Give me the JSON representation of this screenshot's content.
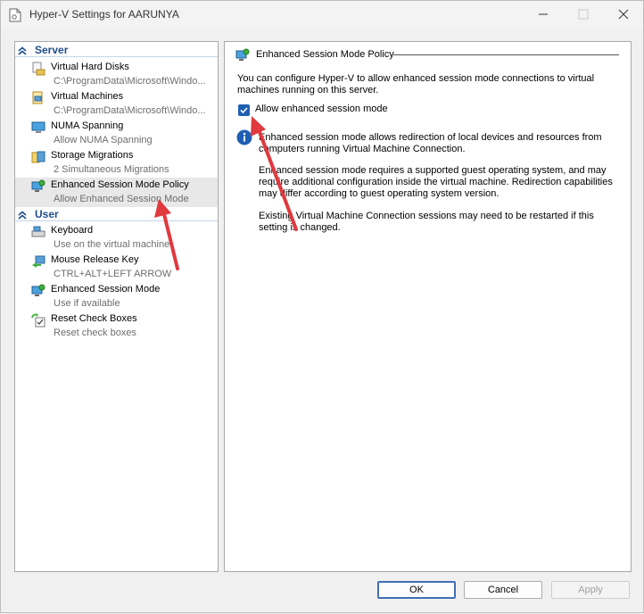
{
  "window": {
    "title": "Hyper-V Settings for AARUNYA"
  },
  "sidebar": {
    "categories": [
      {
        "label": "Server",
        "items": [
          {
            "title": "Virtual Hard Disks",
            "subtitle": "C:\\ProgramData\\Microsoft\\Windo...",
            "icon": "hard-disk-folder-icon"
          },
          {
            "title": "Virtual Machines",
            "subtitle": "C:\\ProgramData\\Microsoft\\Windo...",
            "icon": "virtual-machine-folder-icon"
          },
          {
            "title": "NUMA Spanning",
            "subtitle": "Allow NUMA Spanning",
            "icon": "numa-monitor-icon"
          },
          {
            "title": "Storage Migrations",
            "subtitle": "2 Simultaneous Migrations",
            "icon": "storage-migration-icon"
          },
          {
            "title": "Enhanced Session Mode Policy",
            "subtitle": "Allow Enhanced Session Mode",
            "icon": "enhanced-session-icon",
            "selected": true
          }
        ]
      },
      {
        "label": "User",
        "items": [
          {
            "title": "Keyboard",
            "subtitle": "Use on the virtual machine",
            "icon": "keyboard-icon"
          },
          {
            "title": "Mouse Release Key",
            "subtitle": "CTRL+ALT+LEFT ARROW",
            "icon": "mouse-release-icon"
          },
          {
            "title": "Enhanced Session Mode",
            "subtitle": "Use if available",
            "icon": "enhanced-session-icon"
          },
          {
            "title": "Reset Check Boxes",
            "subtitle": "Reset check boxes",
            "icon": "reset-checkbox-icon"
          }
        ]
      }
    ]
  },
  "panel": {
    "title": "Enhanced Session Mode Policy",
    "intro": "You can configure Hyper-V to allow enhanced session mode connections to virtual machines running on this server.",
    "checkbox_label": "Allow enhanced session mode",
    "checkbox_checked": true,
    "info_paragraphs": [
      "Enhanced session mode allows redirection of local devices and resources from computers running Virtual Machine Connection.",
      "Enhanced session mode requires a supported guest operating system, and may require additional configuration inside the virtual machine. Redirection capabilities may differ according to guest operating system version.",
      "Existing Virtual Machine Connection sessions may need to be restarted if this setting is changed."
    ]
  },
  "buttons": {
    "ok": "OK",
    "cancel": "Cancel",
    "apply": "Apply"
  },
  "colors": {
    "accent": "#1e5fb4",
    "category_text": "#1e4e8c",
    "annotation_arrow": "#e0393e"
  }
}
